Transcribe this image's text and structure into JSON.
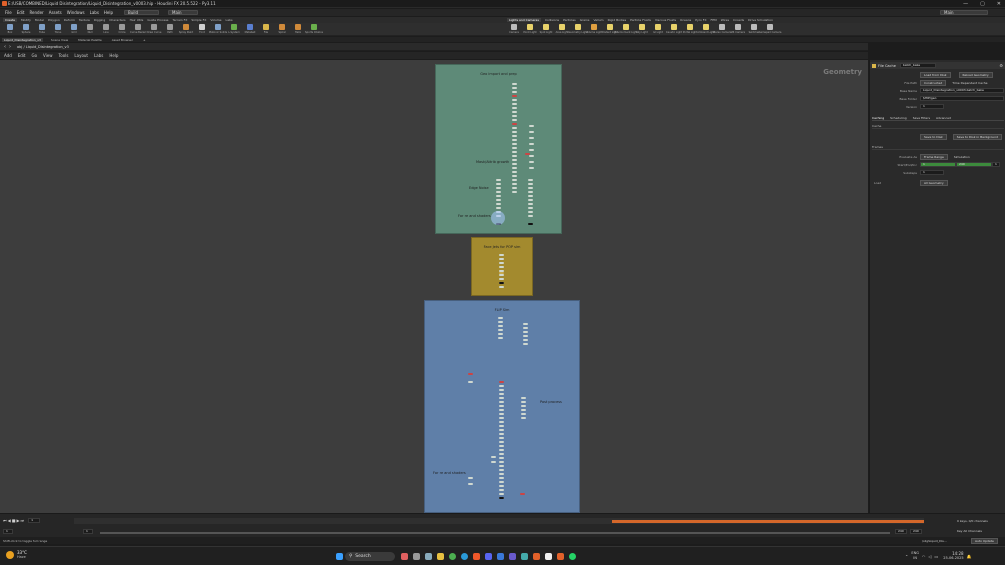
{
  "window": {
    "title": "E:/USB/COMBINED/Liquid Disintegration/Liquid_Disintegration_v0003.hip - Houdini FX 20.5.522 - Py3.11",
    "controls": [
      "—",
      "▢",
      "✕"
    ]
  },
  "menubar": {
    "items": [
      "File",
      "Edit",
      "Render",
      "Assets",
      "Windows",
      "Labs",
      "Help"
    ],
    "desktop": "Main",
    "build": "Build",
    "right": "Main"
  },
  "shelf_tabs_left": [
    "Create",
    "Modify",
    "Model",
    "Polygon",
    "Deform",
    "Texture",
    "Rigging",
    "Characters",
    "Hair Utils",
    "Guide Process",
    "Terrain FX",
    "Simple FX",
    "Volume",
    "Labs"
  ],
  "shelf_tabs_right": [
    "Lights and Cameras",
    "Collisions",
    "Particles",
    "Grains",
    "Vellum",
    "Rigid Bodies",
    "Particle Fluids",
    "Viscous Fluids",
    "Oceans",
    "Pyro FX",
    "FEM",
    "Wires",
    "Crowds",
    "Drive Simulation"
  ],
  "tools_left": [
    {
      "label": "Box",
      "color": "#7fa0c8"
    },
    {
      "label": "Sphere",
      "color": "#7fa0c8"
    },
    {
      "label": "Tube",
      "color": "#7fa0c8"
    },
    {
      "label": "Torus",
      "color": "#7fa0c8"
    },
    {
      "label": "Grid",
      "color": "#7fa0c8"
    },
    {
      "label": "Null",
      "color": "#9a9a9a"
    },
    {
      "label": "Line",
      "color": "#9a9a9a"
    },
    {
      "label": "Circle",
      "color": "#9a9a9a"
    },
    {
      "label": "Curve Bezier",
      "color": "#9a9a9a"
    },
    {
      "label": "Draw Curve",
      "color": "#9a9a9a"
    },
    {
      "label": "Path",
      "color": "#9a9a9a"
    },
    {
      "label": "Spray Paint",
      "color": "#d08a3a"
    },
    {
      "label": "Font",
      "color": "#cfcfcf"
    },
    {
      "label": "Platonic Solids",
      "color": "#7fa0c8"
    },
    {
      "label": "L-System",
      "color": "#6ab04c"
    },
    {
      "label": "Metaball",
      "color": "#5a7fd0"
    },
    {
      "label": "File",
      "color": "#d9b64a"
    },
    {
      "label": "Spiral",
      "color": "#d08a3a"
    },
    {
      "label": "Helix",
      "color": "#d08a3a"
    },
    {
      "label": "Sports Chalice",
      "color": "#6ab04c"
    }
  ],
  "tools_right": [
    {
      "label": "Camera",
      "color": "#bbb"
    },
    {
      "label": "Point Light",
      "color": "#e8d26a"
    },
    {
      "label": "Spot Light",
      "color": "#e8d26a"
    },
    {
      "label": "Area Light",
      "color": "#e8d26a"
    },
    {
      "label": "Geometry Light",
      "color": "#e8d26a"
    },
    {
      "label": "Volume Light",
      "color": "#e0a040"
    },
    {
      "label": "Distant Light",
      "color": "#e8d26a"
    },
    {
      "label": "Environment Light",
      "color": "#e8d26a"
    },
    {
      "label": "Sky Light",
      "color": "#e8d26a"
    },
    {
      "label": "GI Light",
      "color": "#e8d26a"
    },
    {
      "label": "Caustic Light",
      "color": "#e8d26a"
    },
    {
      "label": "Portal Light",
      "color": "#e8d26a"
    },
    {
      "label": "Ambient Light",
      "color": "#e8d26a"
    },
    {
      "label": "Stereo Camera",
      "color": "#bbb"
    },
    {
      "label": "VR Camera",
      "color": "#bbb"
    },
    {
      "label": "Switcher",
      "color": "#bbb"
    },
    {
      "label": "Gamepad Camera",
      "color": "#bbb"
    }
  ],
  "pane_tabs": [
    "Liquid_Disintegration_v3",
    "Scene View",
    "Material Palette",
    "Asset Browser"
  ],
  "path": "obj / Liquid_Disintegration_v3",
  "network_menu": [
    "Add",
    "Edit",
    "Go",
    "View",
    "Tools",
    "Layout",
    "Labs",
    "Help"
  ],
  "network": {
    "context_label": "Geometry",
    "box_green": {
      "title": "Geo import and prep",
      "labels": {
        "mask": "Mask/Attrib growth",
        "edge": "Edge Noise",
        "shader": "For re and shaders"
      }
    },
    "box_yellow": {
      "title": "Face Jets for POP sim"
    },
    "box_blue": {
      "title": "FLIP Sim",
      "labels": {
        "post": "Post process",
        "shader": "For re and shaders"
      }
    }
  },
  "parameters": {
    "node_type": "File Cache",
    "node_name": "batch_bake",
    "load_from_disk": "Load from Disk",
    "reload_geometry": "Reload Geometry",
    "file_path_label": "File Path",
    "file_path_mode": "Constructed",
    "time_dependent": "Time Dependent Cache",
    "base_name_label": "Base Name",
    "base_name": "Liquid_Disintegration_v0003.batch_bake",
    "base_folder_label": "Base Folder",
    "base_folder": "$HIP/geo",
    "version_label": "Version",
    "version": "1",
    "tabs": [
      "Caching",
      "Scheduling",
      "Save Filters",
      "Advanced"
    ],
    "cache_section": "Cache",
    "save_to_disk": "Save to Disk",
    "save_bg": "Save to Disk in Background",
    "frames_section": "Frames",
    "evaluate_as_label": "Evaluate As",
    "evaluate_as": "Frame Range",
    "simulation": "Simulation",
    "start_end_label": "Start/End/Inc",
    "start": "1",
    "end": "240",
    "inc": "1",
    "substeps_label": "Substeps",
    "substeps": "1",
    "load_label": "Load",
    "load_value": "All Geometry"
  },
  "timeline": {
    "frame": "1",
    "start": "1",
    "end": "1",
    "range_end": "240",
    "range_end2": "240",
    "right_label": "0 keys, 0/0 channels",
    "key_all": "Key All Channels",
    "auto_update": "Auto Update",
    "scene_label": "/obj/Liquid_Dis..."
  },
  "status": {
    "message": "Shift-click to toggle full range"
  },
  "taskbar": {
    "weather_temp": "33°C",
    "weather_desc": "Haze",
    "search": "Search",
    "lang": "ENG",
    "lang2": "IN",
    "time": "14:28",
    "date": "25-06-2025"
  }
}
